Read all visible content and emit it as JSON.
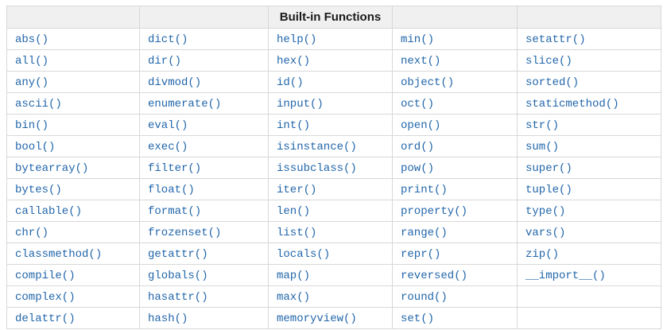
{
  "table": {
    "title": "Built-in Functions",
    "header_cells": [
      "",
      "",
      "Built-in Functions",
      "",
      ""
    ],
    "rows": [
      [
        "abs()",
        "dict()",
        "help()",
        "min()",
        "setattr()"
      ],
      [
        "all()",
        "dir()",
        "hex()",
        "next()",
        "slice()"
      ],
      [
        "any()",
        "divmod()",
        "id()",
        "object()",
        "sorted()"
      ],
      [
        "ascii()",
        "enumerate()",
        "input()",
        "oct()",
        "staticmethod()"
      ],
      [
        "bin()",
        "eval()",
        "int()",
        "open()",
        "str()"
      ],
      [
        "bool()",
        "exec()",
        "isinstance()",
        "ord()",
        "sum()"
      ],
      [
        "bytearray()",
        "filter()",
        "issubclass()",
        "pow()",
        "super()"
      ],
      [
        "bytes()",
        "float()",
        "iter()",
        "print()",
        "tuple()"
      ],
      [
        "callable()",
        "format()",
        "len()",
        "property()",
        "type()"
      ],
      [
        "chr()",
        "frozenset()",
        "list()",
        "range()",
        "vars()"
      ],
      [
        "classmethod()",
        "getattr()",
        "locals()",
        "repr()",
        "zip()"
      ],
      [
        "compile()",
        "globals()",
        "map()",
        "reversed()",
        "__import__()"
      ],
      [
        "complex()",
        "hasattr()",
        "max()",
        "round()",
        ""
      ],
      [
        "delattr()",
        "hash()",
        "memoryview()",
        "set()",
        ""
      ]
    ]
  },
  "colors": {
    "link_blue": "#2266aa",
    "header_background": "#f0f0f0",
    "border_gray": "#d8d8d8"
  }
}
